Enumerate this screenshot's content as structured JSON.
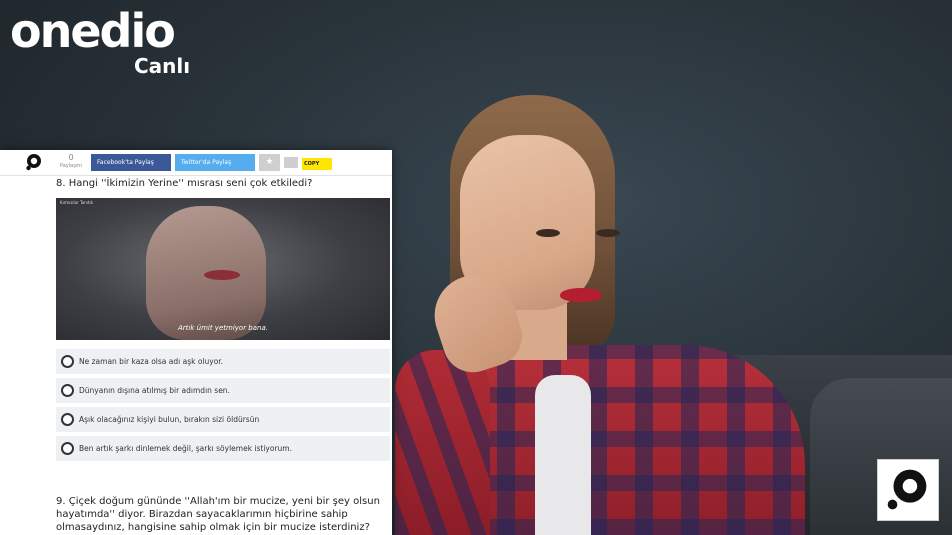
{
  "brand": {
    "name": "onedio",
    "subtitle": "Canlı"
  },
  "toolbar": {
    "share_count": "0",
    "share_count_label": "Paylaşım",
    "facebook_label": "Facebook'ta Paylaş",
    "twitter_label": "Twitter'da Paylaş",
    "star_icon": "★",
    "copy_label": "COPY"
  },
  "question8": {
    "title": "8. Hangi ''İkimizin Yerine'' mısrası seni çok etkiledi?",
    "image_tag": "Kırmızılar Tanıtık",
    "image_subtitle": "Artık ümit yetmiyor bana.",
    "options": [
      {
        "label": "Ne zaman bir kaza olsa adı aşk oluyor."
      },
      {
        "label": "Dünyanın dışına atılmış bir adımdın sen."
      },
      {
        "label": "Aşık olacağınız kişiyi bulun, bırakın sizi öldürsün"
      },
      {
        "label": "Ben artık şarkı dinlemek değil, şarkı söylemek istiyorum."
      }
    ]
  },
  "question9": {
    "title": "9. Çiçek doğum gününde ''Allah'ım bir mucize, yeni bir şey olsun hayatımda'' diyor. Birazdan sayacaklarımın hiçbirine sahip olmasaydınız, hangisine sahip olmak için bir mucize isterdiniz?"
  },
  "colors": {
    "facebook": "#3b5998",
    "twitter": "#55acee",
    "copy": "#ffe600"
  }
}
